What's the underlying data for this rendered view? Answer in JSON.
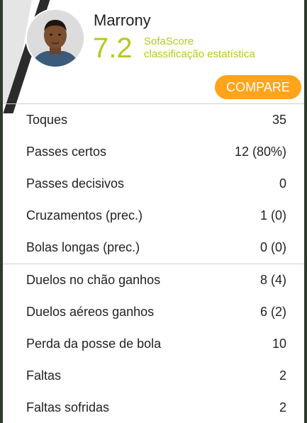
{
  "player": {
    "name": "Marrony",
    "rating": "7.2",
    "rating_source": "SofaScore",
    "rating_label": "classificação estatística"
  },
  "compare_label": "COMPARE",
  "colors": {
    "accent_rating": "#b7c91c",
    "compare_button": "#ffa41b"
  },
  "stats_group_1": [
    {
      "label": "Toques",
      "value": "35"
    },
    {
      "label": "Passes certos",
      "value": "12 (80%)"
    },
    {
      "label": "Passes decisivos",
      "value": "0"
    },
    {
      "label": "Cruzamentos (prec.)",
      "value": "1 (0)"
    },
    {
      "label": "Bolas longas (prec.)",
      "value": "0 (0)"
    }
  ],
  "stats_group_2": [
    {
      "label": "Duelos no chão ganhos",
      "value": "8 (4)"
    },
    {
      "label": "Duelos aéreos ganhos",
      "value": "6 (2)"
    },
    {
      "label": "Perda da posse de bola",
      "value": "10"
    },
    {
      "label": "Faltas",
      "value": "2"
    },
    {
      "label": "Faltas sofridas",
      "value": "2"
    }
  ]
}
